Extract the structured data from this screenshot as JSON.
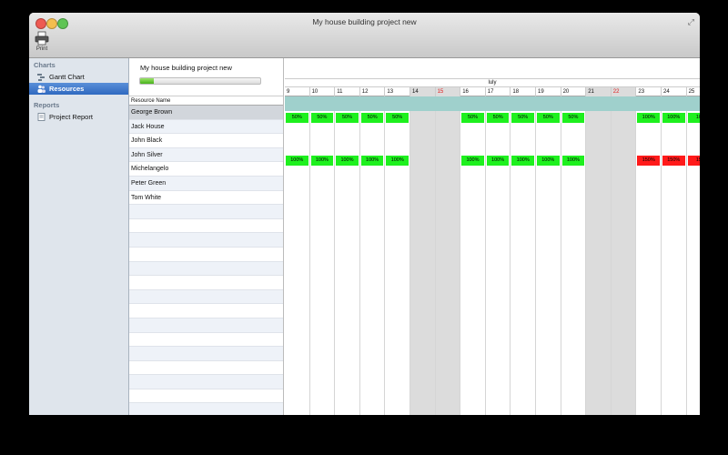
{
  "window": {
    "title": "My house building project new"
  },
  "toolbar": {
    "print_label": "Print"
  },
  "sidebar": {
    "sections": [
      {
        "title": "Charts",
        "items": [
          {
            "label": "Gantt Chart",
            "icon": "gantt-icon"
          },
          {
            "label": "Resources",
            "icon": "resources-icon",
            "selected": true
          }
        ]
      },
      {
        "title": "Reports",
        "items": [
          {
            "label": "Project Report",
            "icon": "report-icon"
          }
        ]
      }
    ]
  },
  "project": {
    "name": "My house building project new",
    "progress": 0.11
  },
  "resources": {
    "column_header": "Resource Name",
    "rows": [
      "George Brown",
      "Jack House",
      "John Black",
      "John Silver",
      "Michelangelo",
      "Peter Green",
      "Tom White"
    ],
    "empty_rows": 15
  },
  "chart": {
    "month": "luly",
    "days": [
      {
        "label": "9"
      },
      {
        "label": "10"
      },
      {
        "label": "11"
      },
      {
        "label": "12"
      },
      {
        "label": "13"
      },
      {
        "label": "14",
        "weekend": true
      },
      {
        "label": "15",
        "weekend": true,
        "red": true
      },
      {
        "label": "16"
      },
      {
        "label": "17"
      },
      {
        "label": "18"
      },
      {
        "label": "19"
      },
      {
        "label": "20"
      },
      {
        "label": "21",
        "weekend": true
      },
      {
        "label": "22",
        "weekend": true,
        "red": true
      },
      {
        "label": "23"
      },
      {
        "label": "24"
      },
      {
        "label": "25"
      }
    ],
    "allocations": [
      {
        "resource": "Jack House",
        "cells": [
          {
            "day": 0,
            "text": "50%",
            "status": "ok"
          },
          {
            "day": 1,
            "text": "50%",
            "status": "ok"
          },
          {
            "day": 2,
            "text": "50%",
            "status": "ok"
          },
          {
            "day": 3,
            "text": "50%",
            "status": "ok"
          },
          {
            "day": 4,
            "text": "50%",
            "status": "ok"
          },
          {
            "day": 7,
            "text": "50%",
            "status": "ok"
          },
          {
            "day": 8,
            "text": "50%",
            "status": "ok"
          },
          {
            "day": 9,
            "text": "50%",
            "status": "ok"
          },
          {
            "day": 10,
            "text": "50%",
            "status": "ok"
          },
          {
            "day": 11,
            "text": "50%",
            "status": "ok"
          },
          {
            "day": 14,
            "text": "100%",
            "status": "ok"
          },
          {
            "day": 15,
            "text": "100%",
            "status": "ok"
          },
          {
            "day": 16,
            "text": "10",
            "status": "ok"
          }
        ]
      },
      {
        "resource": "Michelangelo",
        "cells": [
          {
            "day": 0,
            "text": "100%",
            "status": "ok"
          },
          {
            "day": 1,
            "text": "100%",
            "status": "ok"
          },
          {
            "day": 2,
            "text": "100%",
            "status": "ok"
          },
          {
            "day": 3,
            "text": "100%",
            "status": "ok"
          },
          {
            "day": 4,
            "text": "100%",
            "status": "ok"
          },
          {
            "day": 7,
            "text": "100%",
            "status": "ok"
          },
          {
            "day": 8,
            "text": "100%",
            "status": "ok"
          },
          {
            "day": 9,
            "text": "100%",
            "status": "ok"
          },
          {
            "day": 10,
            "text": "100%",
            "status": "ok"
          },
          {
            "day": 11,
            "text": "100%",
            "status": "ok"
          },
          {
            "day": 14,
            "text": "150%",
            "status": "over"
          },
          {
            "day": 15,
            "text": "150%",
            "status": "over"
          },
          {
            "day": 16,
            "text": "15",
            "status": "over"
          }
        ]
      }
    ],
    "colors": {
      "ok": "#1ef01e",
      "over": "#ff1a1a",
      "group": "#9fd0cc"
    }
  }
}
